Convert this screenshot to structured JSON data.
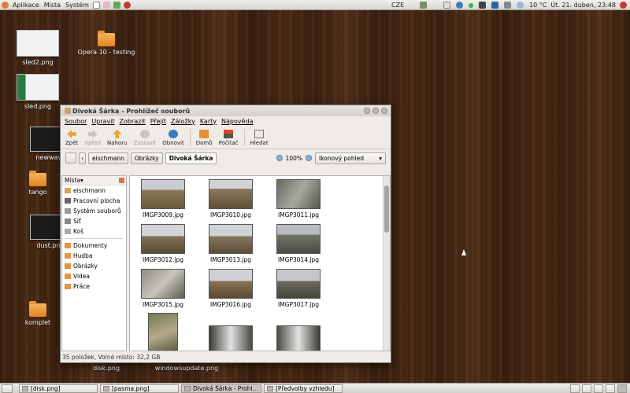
{
  "top_panel": {
    "menus": [
      "Aplikace",
      "Místa",
      "Systém"
    ],
    "keyboard": "CZE",
    "temperature": "10 °C",
    "clock": "Út. 21. duben, 23:48"
  },
  "desktop_icons": [
    {
      "label": "sled2.png"
    },
    {
      "label": "sled.png"
    },
    {
      "label": "newwave..."
    },
    {
      "label": "tango"
    },
    {
      "label": "dust.png"
    },
    {
      "label": "komplet"
    },
    {
      "label": "Opera 10 - testing"
    },
    {
      "label": "disk.png"
    },
    {
      "label": "windowsupdate.png"
    }
  ],
  "window": {
    "title": "Divoká Šárka - Prohlížeč souborů",
    "menu": [
      "Soubor",
      "Upravit",
      "Zobrazit",
      "Přejít",
      "Záložky",
      "Karty",
      "Nápověda"
    ],
    "toolbar": {
      "back": "Zpět",
      "forward": "Vpřed",
      "up": "Nahoru",
      "stop": "Zastavit",
      "reload": "Obnovit",
      "home": "Domů",
      "computer": "Počítač",
      "search": "Hledat"
    },
    "breadcrumbs": [
      "eischmann",
      "Obrázky",
      "Divoká Šárka"
    ],
    "zoom": "100%",
    "view_mode": "Ikonový pohled",
    "sidebar": {
      "header": "Místa",
      "places": [
        "eischmann",
        "Pracovní plocha",
        "Systém souborů",
        "Síť",
        "Koš"
      ],
      "bookmarks": [
        "Dokumenty",
        "Hudba",
        "Obrázky",
        "Videa",
        "Práce"
      ]
    },
    "files": [
      "IMGP3009.jpg",
      "IMGP3010.jpg",
      "IMGP3011.jpg",
      "IMGP3012.jpg",
      "IMGP3013.jpg",
      "IMGP3014.jpg",
      "IMGP3015.jpg",
      "IMGP3016.jpg",
      "IMGP3017.jpg"
    ],
    "status": "35 položek, Volné místo: 32,2 GB"
  },
  "taskbar": [
    "[disk.png]",
    "[pasma.png]",
    "Divoká Šárka - Prohl...",
    "[Předvolby vzhledu]"
  ]
}
